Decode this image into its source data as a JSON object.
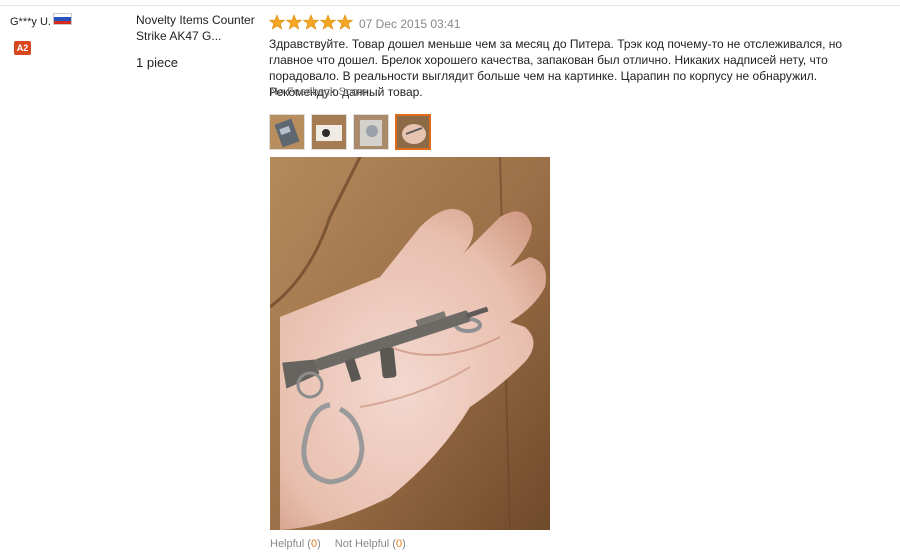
{
  "reviewer": {
    "name": "G***y U.",
    "country_flag": "russia-flag-icon",
    "flag_colors": [
      "#ffffff",
      "#2a52be",
      "#d52b1e"
    ],
    "level_badge": "A2",
    "badge_color": "#d9481c"
  },
  "product": {
    "title": "Novelty Items Counter Strike AK47 G...",
    "quantity": "1 piece"
  },
  "review": {
    "rating": 5,
    "star_color": "#f5a623",
    "date": "07 Dec 2015 03:41",
    "text": "Здравствуйте. Товар дошел меньше чем за месяц до Питера. Трэк код почему-то не отслеживался, но главное что дошел. Брелок хорошего качества, запакован был отлично. Никаких надписей нету, что порадовало. В реальности выглядит больше чем на картинке. Царапин по корпусу не обнаружил. Рекомендую данный товар.",
    "feedback_score": "No Feedback Score",
    "thumbnails": [
      "photo-thumbnail-1",
      "photo-thumbnail-2",
      "photo-thumbnail-3",
      "photo-thumbnail-4"
    ],
    "active_thumbnail": 4,
    "main_photo": "keychain-in-hand-photo"
  },
  "votes": {
    "helpful_label": "Helpful",
    "helpful_open": " (",
    "helpful_count": "0",
    "helpful_close": ")",
    "not_helpful_label": "Not Helpful",
    "not_helpful_open": " (",
    "not_helpful_count": "0",
    "not_helpful_close": ")",
    "count_color": "#e07a1a"
  }
}
